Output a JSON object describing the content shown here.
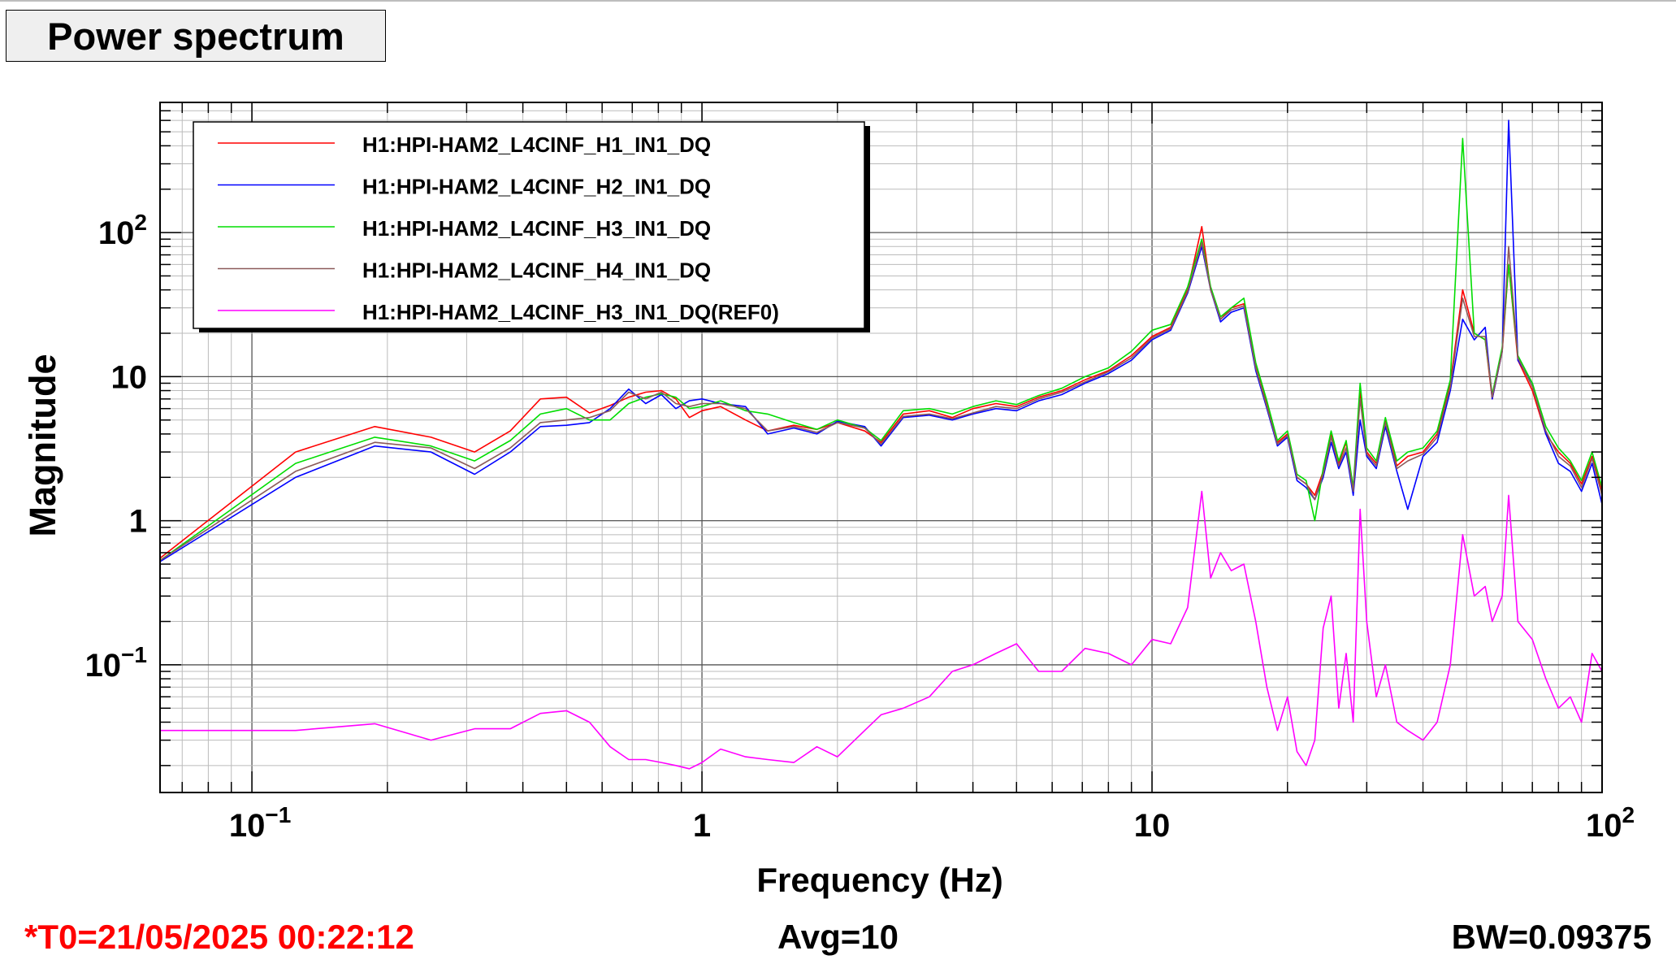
{
  "title": "Power spectrum",
  "footer": {
    "t0": "*T0=21/05/2025 00:22:12",
    "avg": "Avg=10",
    "bw": "BW=0.09375"
  },
  "colors": {
    "t0": "#ff0000",
    "series": [
      "#ff0000",
      "#0000ff",
      "#00dd00",
      "#8b5a5a",
      "#ff00ff"
    ]
  },
  "chart_data": {
    "type": "line",
    "title": "Power spectrum",
    "xlabel": "Frequency (Hz)",
    "ylabel": "Magnitude",
    "xscale": "log",
    "yscale": "log",
    "xlim": [
      0.0625,
      100
    ],
    "ylim": [
      0.013,
      800
    ],
    "grid": true,
    "legend_position": "top-left",
    "x_ticks": [
      {
        "value": 0.1,
        "base": "10",
        "exp": "−1"
      },
      {
        "value": 1,
        "base": "1",
        "exp": ""
      },
      {
        "value": 10,
        "base": "10",
        "exp": ""
      },
      {
        "value": 100,
        "base": "10",
        "exp": "2"
      }
    ],
    "y_ticks": [
      {
        "value": 0.1,
        "base": "10",
        "exp": "−1"
      },
      {
        "value": 1,
        "base": "1",
        "exp": ""
      },
      {
        "value": 10,
        "base": "10",
        "exp": ""
      },
      {
        "value": 100,
        "base": "10",
        "exp": "2"
      }
    ],
    "series": [
      {
        "name": "H1:HPI-HAM2_L4CINF_H1_IN1_DQ",
        "x": [
          0.0625,
          0.125,
          0.1875,
          0.25,
          0.3125,
          0.375,
          0.4375,
          0.5,
          0.5625,
          0.625,
          0.6875,
          0.75,
          0.8125,
          0.875,
          0.9375,
          1.0,
          1.1,
          1.25,
          1.4,
          1.6,
          1.8,
          2.0,
          2.3,
          2.5,
          2.8,
          3.2,
          3.6,
          4.0,
          4.5,
          5.0,
          5.6,
          6.3,
          7.1,
          8.0,
          9.0,
          10.0,
          11.0,
          12.0,
          12.9,
          13.5,
          14.2,
          15.0,
          16.0,
          17.0,
          18.0,
          19.0,
          20.0,
          21.0,
          22.0,
          23.0,
          24.0,
          25.0,
          26.0,
          27.0,
          28.0,
          29.0,
          30.0,
          31.5,
          33.0,
          35.0,
          37.0,
          40.0,
          43.0,
          46.0,
          49.0,
          52.0,
          55.0,
          57.0,
          60.0,
          62.0,
          65.0,
          70.0,
          75.0,
          80.0,
          85.0,
          90.0,
          95.0,
          100.0
        ],
        "y": [
          0.55,
          3.0,
          4.5,
          3.8,
          3.0,
          4.2,
          7.0,
          7.2,
          5.6,
          6.3,
          7.2,
          7.8,
          8.0,
          7.0,
          5.2,
          5.8,
          6.2,
          5.0,
          4.2,
          4.6,
          4.3,
          4.8,
          4.2,
          3.5,
          5.5,
          5.8,
          5.2,
          6.0,
          6.5,
          6.2,
          7.2,
          8.0,
          9.5,
          11.0,
          14.0,
          19.0,
          22.0,
          40.0,
          110.0,
          40.0,
          25.0,
          30.0,
          32.0,
          12.0,
          6.5,
          3.5,
          4.0,
          2.0,
          1.8,
          1.5,
          2.2,
          4.0,
          2.5,
          3.5,
          1.6,
          8.0,
          3.0,
          2.5,
          5.0,
          2.4,
          2.8,
          3.0,
          4.0,
          9.0,
          40.0,
          20.0,
          18.0,
          7.0,
          15.0,
          60.0,
          13.0,
          8.0,
          4.0,
          3.0,
          2.5,
          1.8,
          2.8,
          1.6
        ]
      },
      {
        "name": "H1:HPI-HAM2_L4CINF_H2_IN1_DQ",
        "x": [
          0.0625,
          0.125,
          0.1875,
          0.25,
          0.3125,
          0.375,
          0.4375,
          0.5,
          0.5625,
          0.625,
          0.6875,
          0.75,
          0.8125,
          0.875,
          0.9375,
          1.0,
          1.1,
          1.25,
          1.4,
          1.6,
          1.8,
          2.0,
          2.3,
          2.5,
          2.8,
          3.2,
          3.6,
          4.0,
          4.5,
          5.0,
          5.6,
          6.3,
          7.1,
          8.0,
          9.0,
          10.0,
          11.0,
          12.0,
          12.9,
          13.5,
          14.2,
          15.0,
          16.0,
          17.0,
          18.0,
          19.0,
          20.0,
          21.0,
          22.0,
          23.0,
          24.0,
          25.0,
          26.0,
          27.0,
          28.0,
          29.0,
          30.0,
          31.5,
          33.0,
          35.0,
          37.0,
          40.0,
          43.0,
          46.0,
          49.0,
          52.0,
          55.0,
          57.0,
          60.0,
          62.0,
          65.0,
          70.0,
          75.0,
          80.0,
          85.0,
          90.0,
          95.0,
          100.0
        ],
        "y": [
          0.52,
          2.0,
          3.3,
          3.0,
          2.1,
          3.0,
          4.5,
          4.6,
          4.8,
          6.0,
          8.2,
          6.5,
          7.5,
          6.0,
          6.8,
          7.0,
          6.5,
          6.2,
          4.0,
          4.4,
          4.0,
          4.9,
          4.5,
          3.3,
          5.2,
          5.4,
          5.0,
          5.5,
          6.0,
          5.8,
          6.8,
          7.5,
          9.0,
          10.5,
          13.0,
          18.0,
          21.0,
          38.0,
          80.0,
          40.0,
          24.0,
          28.0,
          30.0,
          11.0,
          6.0,
          3.3,
          3.8,
          1.9,
          1.7,
          1.4,
          2.0,
          3.5,
          2.3,
          3.0,
          1.5,
          5.0,
          2.8,
          2.3,
          4.5,
          2.2,
          1.2,
          2.8,
          3.5,
          8.0,
          25.0,
          18.0,
          22.0,
          7.0,
          15.0,
          600.0,
          13.0,
          9.0,
          4.0,
          2.5,
          2.2,
          1.6,
          2.5,
          1.3
        ]
      },
      {
        "name": "H1:HPI-HAM2_L4CINF_H3_IN1_DQ",
        "x": [
          0.0625,
          0.125,
          0.1875,
          0.25,
          0.3125,
          0.375,
          0.4375,
          0.5,
          0.5625,
          0.625,
          0.6875,
          0.75,
          0.8125,
          0.875,
          0.9375,
          1.0,
          1.1,
          1.25,
          1.4,
          1.6,
          1.8,
          2.0,
          2.3,
          2.5,
          2.8,
          3.2,
          3.6,
          4.0,
          4.5,
          5.0,
          5.6,
          6.3,
          7.1,
          8.0,
          9.0,
          10.0,
          11.0,
          12.0,
          12.9,
          13.5,
          14.2,
          15.0,
          16.0,
          17.0,
          18.0,
          19.0,
          20.0,
          21.0,
          22.0,
          23.0,
          24.0,
          25.0,
          26.0,
          27.0,
          28.0,
          29.0,
          30.0,
          31.5,
          33.0,
          35.0,
          37.0,
          40.0,
          43.0,
          46.0,
          49.0,
          52.0,
          55.0,
          57.0,
          60.0,
          62.0,
          65.0,
          70.0,
          75.0,
          80.0,
          85.0,
          90.0,
          95.0,
          100.0
        ],
        "y": [
          0.53,
          2.5,
          3.8,
          3.3,
          2.6,
          3.6,
          5.5,
          6.0,
          5.0,
          5.0,
          6.5,
          7.2,
          7.6,
          7.2,
          6.0,
          6.2,
          6.8,
          5.8,
          5.5,
          4.8,
          4.3,
          5.0,
          4.4,
          3.6,
          5.8,
          6.0,
          5.5,
          6.2,
          6.8,
          6.4,
          7.4,
          8.3,
          10.0,
          11.5,
          15.0,
          21.0,
          23.0,
          42.0,
          90.0,
          42.0,
          26.0,
          30.0,
          35.0,
          12.5,
          6.8,
          3.6,
          4.2,
          2.1,
          1.9,
          1.0,
          2.3,
          4.2,
          2.6,
          3.6,
          1.7,
          9.0,
          3.2,
          2.6,
          5.2,
          2.6,
          3.0,
          3.2,
          4.2,
          9.5,
          450.0,
          20.0,
          18.0,
          7.5,
          16.0,
          60.0,
          14.0,
          9.0,
          4.5,
          3.2,
          2.6,
          1.9,
          3.0,
          1.7
        ]
      },
      {
        "name": "H1:HPI-HAM2_L4CINF_H4_IN1_DQ",
        "x": [
          0.0625,
          0.125,
          0.1875,
          0.25,
          0.3125,
          0.375,
          0.4375,
          0.5,
          0.5625,
          0.625,
          0.6875,
          0.75,
          0.8125,
          0.875,
          0.9375,
          1.0,
          1.1,
          1.25,
          1.4,
          1.6,
          1.8,
          2.0,
          2.3,
          2.5,
          2.8,
          3.2,
          3.6,
          4.0,
          4.5,
          5.0,
          5.6,
          6.3,
          7.1,
          8.0,
          9.0,
          10.0,
          11.0,
          12.0,
          12.9,
          13.5,
          14.2,
          15.0,
          16.0,
          17.0,
          18.0,
          19.0,
          20.0,
          21.0,
          22.0,
          23.0,
          24.0,
          25.0,
          26.0,
          27.0,
          28.0,
          29.0,
          30.0,
          31.5,
          33.0,
          35.0,
          37.0,
          40.0,
          43.0,
          46.0,
          49.0,
          52.0,
          55.0,
          57.0,
          60.0,
          62.0,
          65.0,
          70.0,
          75.0,
          80.0,
          85.0,
          90.0,
          95.0,
          100.0
        ],
        "y": [
          0.53,
          2.2,
          3.5,
          3.2,
          2.3,
          3.2,
          4.8,
          5.0,
          5.2,
          5.8,
          7.8,
          7.0,
          7.8,
          6.5,
          6.2,
          6.5,
          6.5,
          6.0,
          4.2,
          4.5,
          4.1,
          4.8,
          4.4,
          3.4,
          5.3,
          5.5,
          5.1,
          5.6,
          6.2,
          6.0,
          7.0,
          7.8,
          9.2,
          10.8,
          13.5,
          18.5,
          21.5,
          39.0,
          85.0,
          40.0,
          25.0,
          29.0,
          31.0,
          11.5,
          6.2,
          3.4,
          3.9,
          2.0,
          1.8,
          1.4,
          2.1,
          3.8,
          2.4,
          3.2,
          1.6,
          7.0,
          2.9,
          2.4,
          4.8,
          2.3,
          2.6,
          2.9,
          3.8,
          8.5,
          35.0,
          19.0,
          19.0,
          7.2,
          15.0,
          80.0,
          13.5,
          8.5,
          4.2,
          2.8,
          2.4,
          1.7,
          2.7,
          1.5
        ]
      },
      {
        "name": "H1:HPI-HAM2_L4CINF_H3_IN1_DQ(REF0)",
        "x": [
          0.0625,
          0.125,
          0.1875,
          0.25,
          0.3125,
          0.375,
          0.4375,
          0.5,
          0.5625,
          0.625,
          0.6875,
          0.75,
          0.8125,
          0.875,
          0.9375,
          1.0,
          1.1,
          1.25,
          1.4,
          1.6,
          1.8,
          2.0,
          2.3,
          2.5,
          2.8,
          3.2,
          3.6,
          4.0,
          4.5,
          5.0,
          5.6,
          6.3,
          7.1,
          8.0,
          9.0,
          10.0,
          11.0,
          12.0,
          12.9,
          13.5,
          14.2,
          15.0,
          16.0,
          17.0,
          18.0,
          19.0,
          20.0,
          21.0,
          22.0,
          23.0,
          24.0,
          25.0,
          26.0,
          27.0,
          28.0,
          29.0,
          30.0,
          31.5,
          33.0,
          35.0,
          37.0,
          40.0,
          43.0,
          46.0,
          49.0,
          52.0,
          55.0,
          57.0,
          60.0,
          62.0,
          65.0,
          70.0,
          75.0,
          80.0,
          85.0,
          90.0,
          95.0,
          100.0
        ],
        "y": [
          0.035,
          0.035,
          0.039,
          0.03,
          0.036,
          0.036,
          0.046,
          0.048,
          0.04,
          0.027,
          0.022,
          0.022,
          0.021,
          0.02,
          0.019,
          0.021,
          0.026,
          0.023,
          0.022,
          0.021,
          0.027,
          0.023,
          0.035,
          0.045,
          0.05,
          0.06,
          0.09,
          0.1,
          0.12,
          0.14,
          0.09,
          0.09,
          0.13,
          0.12,
          0.1,
          0.15,
          0.14,
          0.25,
          1.6,
          0.4,
          0.6,
          0.45,
          0.5,
          0.2,
          0.07,
          0.035,
          0.06,
          0.025,
          0.02,
          0.03,
          0.18,
          0.3,
          0.05,
          0.12,
          0.04,
          1.2,
          0.2,
          0.06,
          0.1,
          0.04,
          0.035,
          0.03,
          0.04,
          0.1,
          0.8,
          0.3,
          0.35,
          0.2,
          0.3,
          1.5,
          0.2,
          0.15,
          0.08,
          0.05,
          0.06,
          0.04,
          0.12,
          0.09
        ]
      }
    ]
  }
}
